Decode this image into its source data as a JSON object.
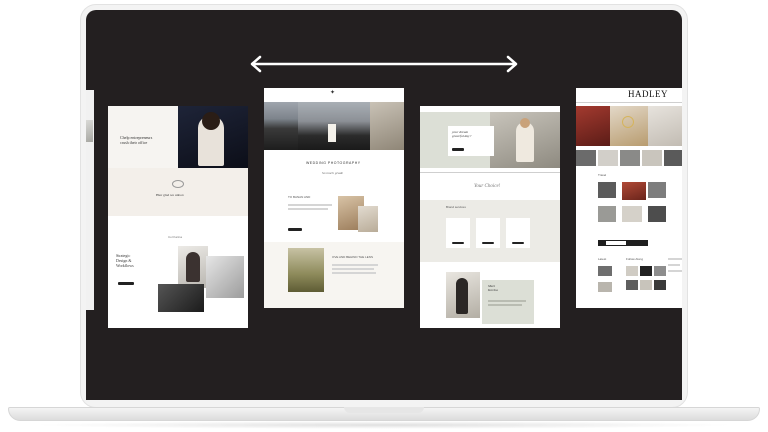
{
  "screen": {
    "background": "#231f20",
    "arrow": {
      "label": "scroll-arrow",
      "color": "#ffffff"
    }
  },
  "templates": [
    {
      "id": "template-1",
      "heading": "Chelp entrepreneurs\ncrush their office",
      "tagline": "Hier glad we unbox",
      "section_label": "Col Karina",
      "subheading": "Strategic\nDesign &\nWorkflows"
    },
    {
      "id": "template-2",
      "heading": "WEDDING PHOTOGRAPHY",
      "script": "So much grade",
      "section_label": "TO BANAN AND",
      "section_2": "OVE AND BEHIND THE LENS"
    },
    {
      "id": "template-3",
      "script_1": "your dream\ngraceful day?",
      "script_2": "Your Choice!",
      "section_label": "Brand services",
      "script_3": "Meet\nKorina"
    },
    {
      "id": "template-4",
      "brand": "HADLEY",
      "section": "Travel",
      "section_2": "Latest",
      "section_3": "Follow Along"
    }
  ],
  "colors": {
    "accent_dark": "#222222",
    "muted_bg": "#f3efea",
    "sage": "#dcdfd6"
  }
}
